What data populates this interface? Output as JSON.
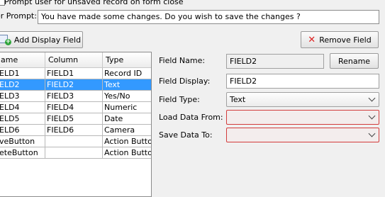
{
  "top": {
    "prompt_checkbox_label": "Prompt user for unsaved record on form close",
    "user_prompt_label": "er Prompt:",
    "user_prompt_value": "You have made some changes. Do you wish to save the changes ?"
  },
  "toolbar": {
    "add_label": "Add Display Field",
    "remove_label": "Remove Field",
    "add_icon": "add-field-icon",
    "remove_icon": "remove-x-icon"
  },
  "table": {
    "headers": [
      "ame",
      "Column",
      "Type"
    ],
    "rows": [
      [
        "ELD1",
        "FIELD1",
        "Record ID"
      ],
      [
        "ELD2",
        "FIELD2",
        "Text"
      ],
      [
        "ELD3",
        "FIELD3",
        "Yes/No"
      ],
      [
        "ELD4",
        "FIELD4",
        "Numeric"
      ],
      [
        "ELD5",
        "FIELD5",
        "Date"
      ],
      [
        "ELD6",
        "FIELD6",
        "Camera"
      ],
      [
        "veButton",
        "",
        "Action Button"
      ],
      [
        "eteButton",
        "",
        "Action Button"
      ]
    ],
    "selected_index": 1
  },
  "form": {
    "field_name_label": "Field Name:",
    "field_name_value": "FIELD2",
    "rename_label": "Rename",
    "field_display_label": "Field Display:",
    "field_display_value": "FIELD2",
    "field_type_label": "Field Type:",
    "field_type_value": "Text",
    "load_data_label": "Load Data From:",
    "load_data_value": "",
    "save_data_label": "Save Data To:",
    "save_data_value": ""
  },
  "colors": {
    "selection": "#3399ff",
    "error_border": "#d23c3c"
  }
}
